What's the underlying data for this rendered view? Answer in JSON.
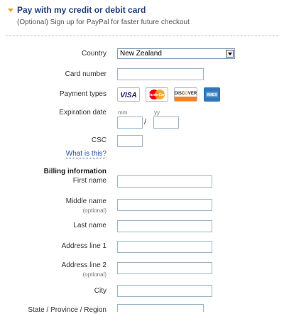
{
  "header": {
    "title": "Pay with my credit or debit card",
    "subtitle": "(Optional) Sign up for PayPal for faster future checkout"
  },
  "form": {
    "country_label": "Country",
    "country_value": "New Zealand",
    "card_number_label": "Card number",
    "payment_types_label": "Payment types",
    "cards": [
      "VISA",
      "MasterCard",
      "DISCOVER",
      "AMEX"
    ],
    "expiration_label": "Expiration date",
    "mm_label": "mm",
    "yy_label": "yy",
    "slash": "/",
    "csc_label": "CSC",
    "csc_help": "What is this?",
    "billing_heading": "Billing information",
    "first_name_label": "First name",
    "middle_name_label": "Middle name",
    "optional": "(optional)",
    "last_name_label": "Last name",
    "address1_label": "Address line 1",
    "address2_label": "Address line 2",
    "city_label": "City",
    "state_label": "State / Province / Region"
  },
  "colors": {
    "title": "#1f3f7a",
    "arrow": "#e8a317",
    "field_border": "#9db5c9",
    "visa": "#1a1f71",
    "mastercard_red": "#eb001b",
    "mastercard_orange": "#f79e1b",
    "discover_orange": "#f58220",
    "amex": "#2e77bc"
  },
  "icons": [
    "expand-arrow-icon",
    "dropdown-chevron-icon",
    "visa-logo",
    "mastercard-logo",
    "discover-logo",
    "amex-logo"
  ]
}
